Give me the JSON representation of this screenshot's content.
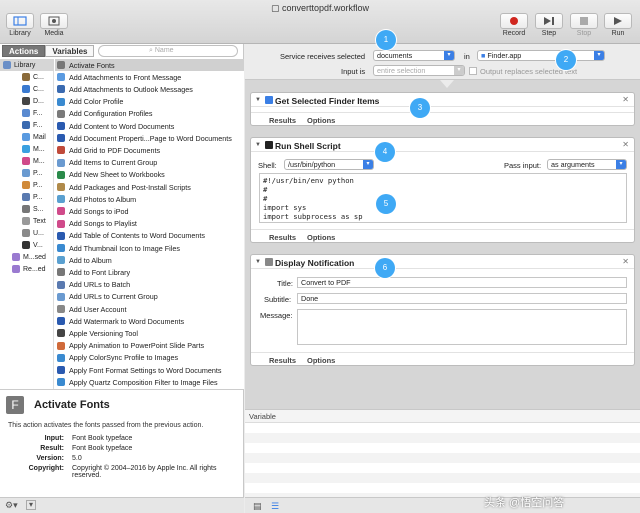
{
  "window": {
    "title": "converttopdf.workflow"
  },
  "toolbar": {
    "library": "Library",
    "media": "Media",
    "record": "Record",
    "step": "Step",
    "stop": "Stop",
    "run": "Run"
  },
  "left": {
    "tab_actions": "Actions",
    "tab_variables": "Variables",
    "search_placeholder": "Name",
    "library_items": [
      {
        "label": "Library",
        "color": "#6a8fc7"
      },
      {
        "label": "C...",
        "color": "#8a6a3a"
      },
      {
        "label": "C...",
        "color": "#3a7ad0"
      },
      {
        "label": "D...",
        "color": "#444444"
      },
      {
        "label": "F...",
        "color": "#5a8ad0"
      },
      {
        "label": "F...",
        "color": "#3a6ab0"
      },
      {
        "label": "Mail",
        "color": "#5a9ae0"
      },
      {
        "label": "M...",
        "color": "#3aa0e0"
      },
      {
        "label": "M...",
        "color": "#d04a8a"
      },
      {
        "label": "P...",
        "color": "#6a9ad0"
      },
      {
        "label": "P...",
        "color": "#d08a3a"
      },
      {
        "label": "P...",
        "color": "#5a7ab0"
      },
      {
        "label": "S...",
        "color": "#777777"
      },
      {
        "label": "Text",
        "color": "#999999"
      },
      {
        "label": "U...",
        "color": "#8a8a8a"
      },
      {
        "label": "V...",
        "color": "#333333"
      },
      {
        "label": "M...sed",
        "color": "#9a7ad0"
      },
      {
        "label": "Re...ed",
        "color": "#9a7ad0"
      }
    ],
    "actions": [
      {
        "label": "Activate Fonts",
        "color": "#777777"
      },
      {
        "label": "Add Attachments to Front Message",
        "color": "#5a9ae0"
      },
      {
        "label": "Add Attachments to Outlook Messages",
        "color": "#3a6ab0"
      },
      {
        "label": "Add Color Profile",
        "color": "#3a8ad0"
      },
      {
        "label": "Add Configuration Profiles",
        "color": "#7a7a7a"
      },
      {
        "label": "Add Content to Word Documents",
        "color": "#2a5ab0"
      },
      {
        "label": "Add Document Properti...Page to Word Documents",
        "color": "#2a5ab0"
      },
      {
        "label": "Add Grid to PDF Documents",
        "color": "#c04a3a"
      },
      {
        "label": "Add Items to Current Group",
        "color": "#6a9ad0"
      },
      {
        "label": "Add New Sheet to Workbooks",
        "color": "#2a8a4a"
      },
      {
        "label": "Add Packages and Post-Install Scripts",
        "color": "#b08a4a"
      },
      {
        "label": "Add Photos to Album",
        "color": "#5aa0d0"
      },
      {
        "label": "Add Songs to iPod",
        "color": "#d04a8a"
      },
      {
        "label": "Add Songs to Playlist",
        "color": "#d04a8a"
      },
      {
        "label": "Add Table of Contents to Word Documents",
        "color": "#2a5ab0"
      },
      {
        "label": "Add Thumbnail Icon to Image Files",
        "color": "#3a8ad0"
      },
      {
        "label": "Add to Album",
        "color": "#5aa0d0"
      },
      {
        "label": "Add to Font Library",
        "color": "#777777"
      },
      {
        "label": "Add URLs to Batch",
        "color": "#5a7ab0"
      },
      {
        "label": "Add URLs to Current Group",
        "color": "#6a9ad0"
      },
      {
        "label": "Add User Account",
        "color": "#888888"
      },
      {
        "label": "Add Watermark to Word Documents",
        "color": "#2a5ab0"
      },
      {
        "label": "Apple Versioning Tool",
        "color": "#444444"
      },
      {
        "label": "Apply Animation to PowerPoint Slide Parts",
        "color": "#d06a3a"
      },
      {
        "label": "Apply ColorSync Profile to Images",
        "color": "#3a8ad0"
      },
      {
        "label": "Apply Font Format Settings to Word Documents",
        "color": "#2a5ab0"
      },
      {
        "label": "Apply Quartz Composition Filter to Image Files",
        "color": "#3a8ad0"
      }
    ]
  },
  "description": {
    "title": "Activate Fonts",
    "text": "This action activates the fonts passed from the previous action.",
    "rows": [
      {
        "key": "Input:",
        "value": "Font Book typeface"
      },
      {
        "key": "Result:",
        "value": "Font Book typeface"
      },
      {
        "key": "Version:",
        "value": "5.0"
      },
      {
        "key": "Copyright:",
        "value": "Copyright © 2004–2016 by Apple Inc. All rights reserved."
      }
    ]
  },
  "service": {
    "receives_label": "Service receives selected",
    "receives_value": "documents",
    "in_label": "in",
    "in_value": "Finder.app",
    "input_is_label": "Input is",
    "input_is_value": "entire selection",
    "output_replaces": "Output replaces selected text"
  },
  "cards": {
    "get_finder": {
      "title": "Get Selected Finder Items"
    },
    "shell": {
      "title": "Run Shell Script",
      "shell_label": "Shell:",
      "shell_value": "/usr/bin/python",
      "pass_label": "Pass input:",
      "pass_value": "as arguments",
      "code": "#!/usr/bin/env python\n#\n#\nimport sys\nimport subprocess as sp"
    },
    "notify": {
      "title": "Display Notification",
      "title_label": "Title:",
      "title_value": "Convert to PDF",
      "subtitle_label": "Subtitle:",
      "subtitle_value": "Done",
      "message_label": "Message:"
    },
    "results": "Results",
    "options": "Options"
  },
  "badges": [
    "1",
    "2",
    "3",
    "4",
    "5",
    "6"
  ],
  "variables": {
    "header": "Variable"
  },
  "watermark": "头条 @悟空问答"
}
